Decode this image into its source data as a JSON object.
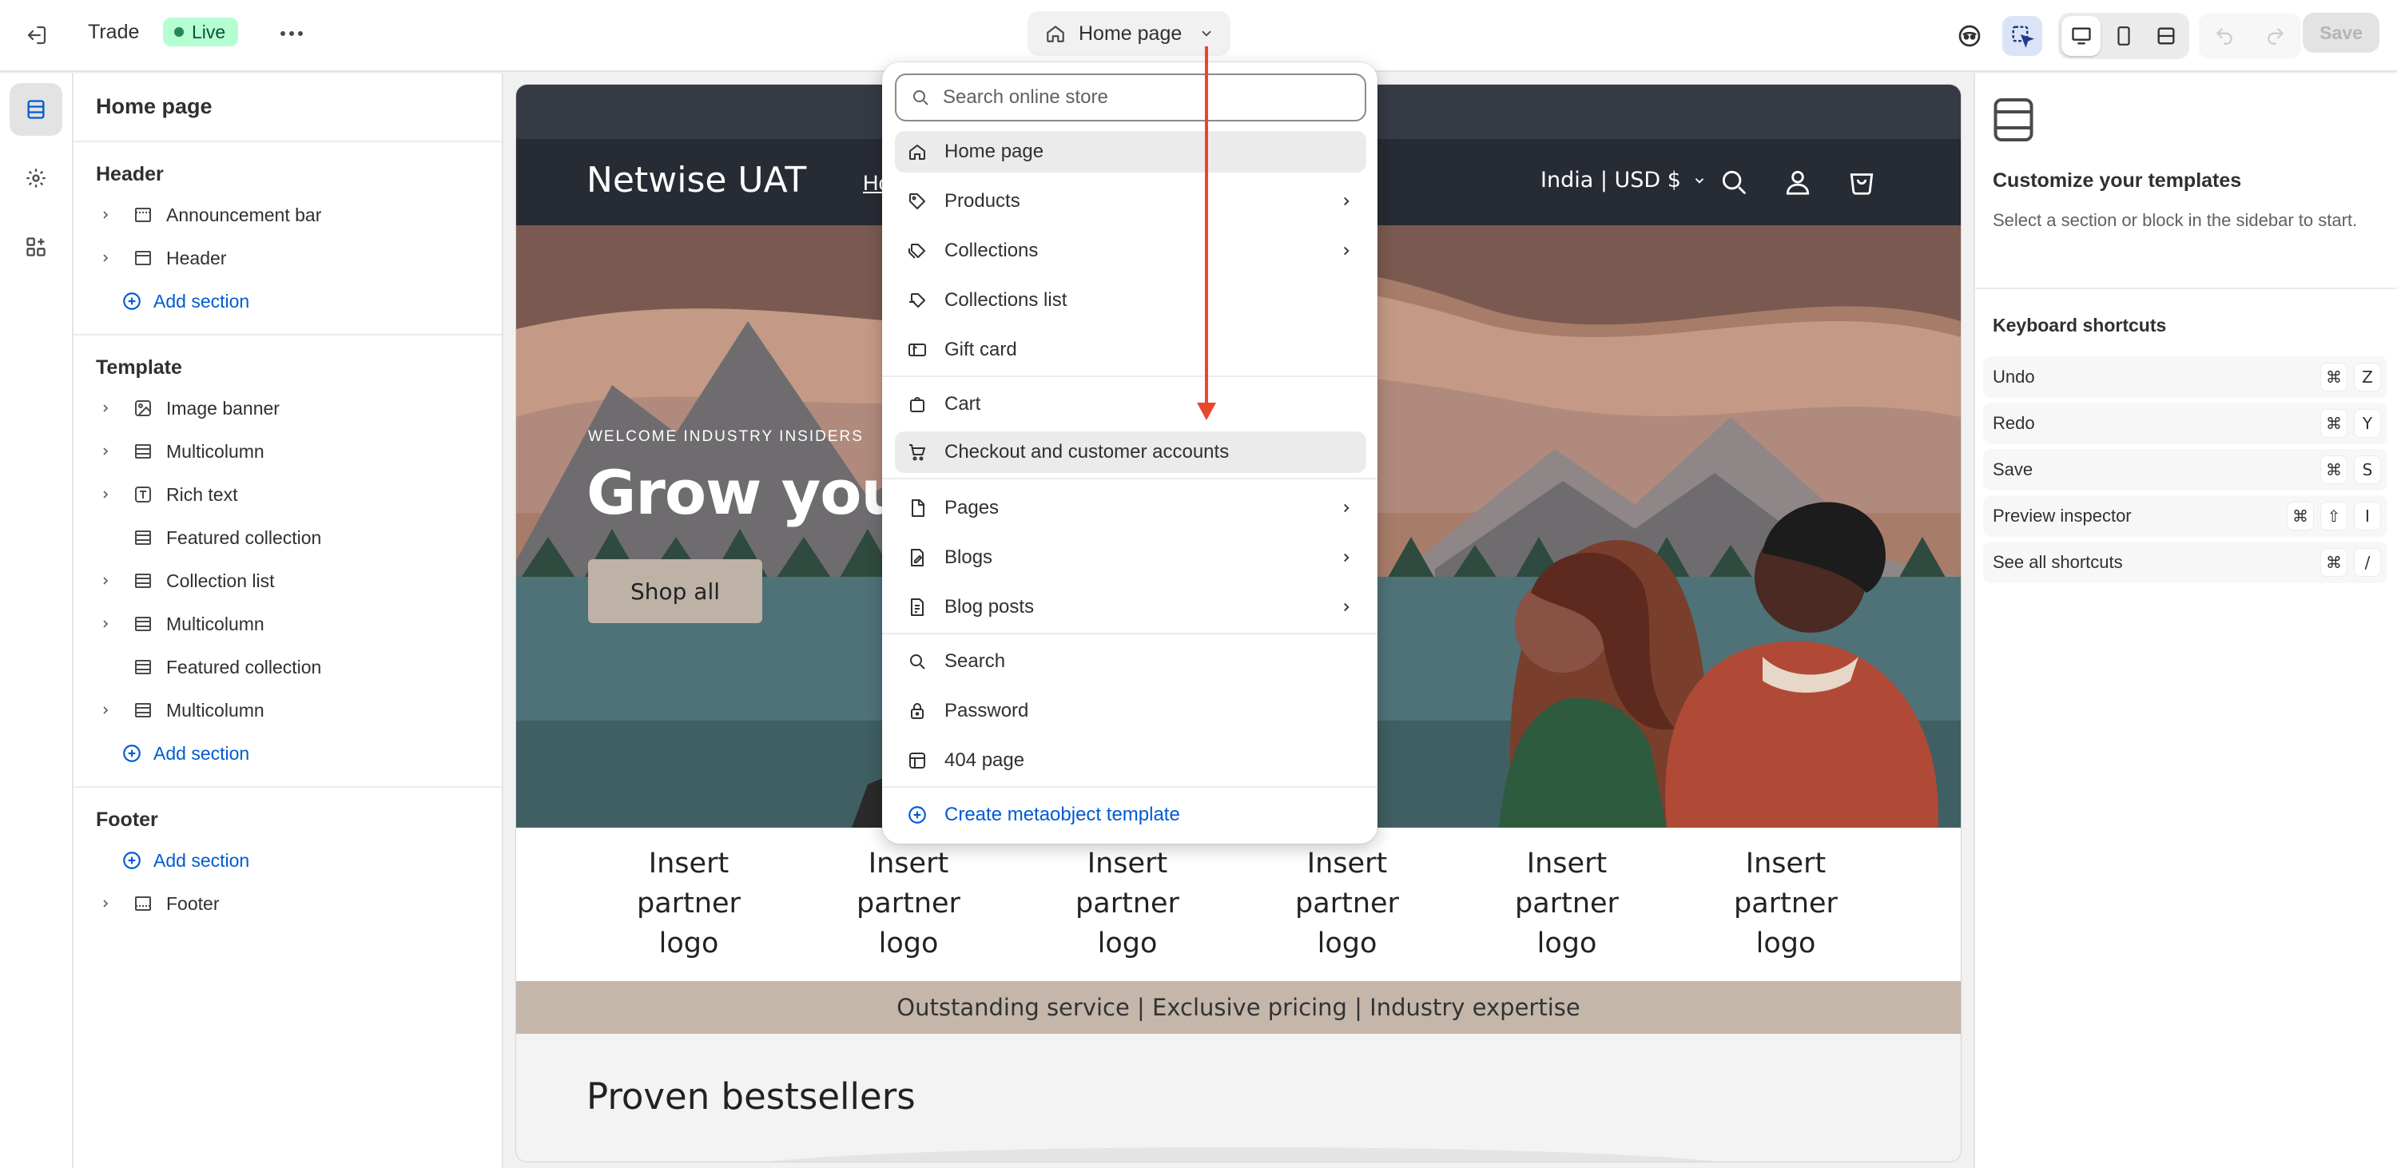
{
  "topbar": {
    "store_name": "Trade",
    "status": "Live",
    "current_page": "Home page",
    "save_label": "Save"
  },
  "sidebar": {
    "title": "Home page",
    "groups": {
      "header": {
        "label": "Header",
        "items": [
          "Announcement bar",
          "Header"
        ],
        "add": "Add section"
      },
      "template": {
        "label": "Template",
        "items": [
          "Image banner",
          "Multicolumn",
          "Rich text",
          "Featured collection",
          "Collection list",
          "Multicolumn",
          "Featured collection",
          "Multicolumn"
        ],
        "add": "Add section"
      },
      "footer": {
        "label": "Footer",
        "add": "Add section",
        "items": [
          "Footer"
        ]
      }
    }
  },
  "preview": {
    "store_logo": "Netwise UAT",
    "nav_item": "Ho",
    "country": "India | USD $",
    "hero_subtitle": "WELCOME INDUSTRY INSIDERS",
    "hero_title": "Grow your b",
    "hero_button": "Shop all",
    "partner_logo_text": [
      "Insert",
      "partner",
      "logo"
    ],
    "strip": "Outstanding service | Exclusive pricing | Industry expertise",
    "section_title": "Proven bestsellers"
  },
  "dropdown": {
    "search_placeholder": "Search online store",
    "items": [
      "Home page",
      "Products",
      "Collections",
      "Collections list",
      "Gift card",
      "Cart",
      "Checkout and customer accounts",
      "Pages",
      "Blogs",
      "Blog posts",
      "Search",
      "Password",
      "404 page"
    ],
    "create_label": "Create metaobject template"
  },
  "right_panel": {
    "title": "Customize your templates",
    "description": "Select a section or block in the sidebar to start.",
    "shortcuts_title": "Keyboard shortcuts",
    "shortcuts": [
      {
        "label": "Undo",
        "keys": [
          "⌘",
          "Z"
        ]
      },
      {
        "label": "Redo",
        "keys": [
          "⌘",
          "Y"
        ]
      },
      {
        "label": "Save",
        "keys": [
          "⌘",
          "S"
        ]
      },
      {
        "label": "Preview inspector",
        "keys": [
          "⌘",
          "⇧",
          "I"
        ]
      },
      {
        "label": "See all shortcuts",
        "keys": [
          "⌘",
          "/"
        ]
      }
    ]
  },
  "colors": {
    "accent": "#005bd3",
    "live_badge": "#b4fed2",
    "annotation_arrow": "#e8472b"
  }
}
